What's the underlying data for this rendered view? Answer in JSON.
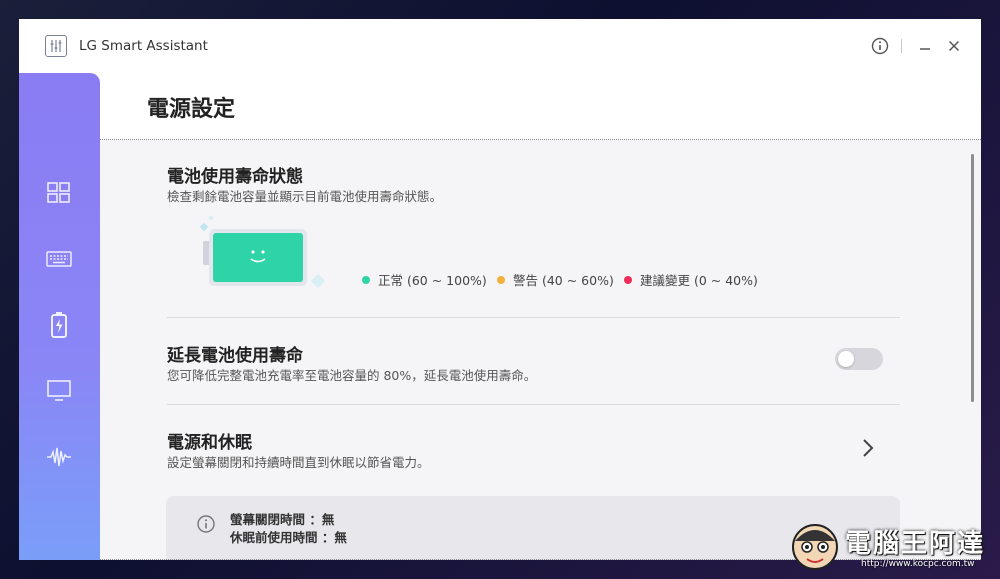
{
  "app": {
    "title": "LG Smart Assistant"
  },
  "titlebar": {
    "info_icon": "info-icon",
    "minimize_icon": "minimize-icon",
    "close_icon": "close-icon"
  },
  "sidebar": {
    "items": [
      {
        "icon": "dashboard-icon"
      },
      {
        "icon": "keyboard-icon"
      },
      {
        "icon": "battery-icon",
        "active": true
      },
      {
        "icon": "monitor-icon"
      },
      {
        "icon": "audio-wave-icon"
      }
    ]
  },
  "page": {
    "title": "電源設定"
  },
  "battery_health": {
    "title": "電池使用壽命狀態",
    "description": "檢查剩餘電池容量並顯示目前電池使用壽命狀態。",
    "legend": [
      {
        "label": "正常 (60 ~ 100%)",
        "color": "#2ed3a8"
      },
      {
        "label": "警告 (40 ~ 60%)",
        "color": "#f0b23a"
      },
      {
        "label": "建議變更 (0 ~ 40%)",
        "color": "#ee2d5a"
      }
    ]
  },
  "extend_battery": {
    "title": "延長電池使用壽命",
    "description": "您可降低完整電池充電率至電池容量的 80%，延長電池使用壽命。",
    "toggle_on": false
  },
  "power_sleep": {
    "title": "電源和休眠",
    "description": "設定螢幕關閉和持續時間直到休眠以節省電力。",
    "info_lines": [
      "螢幕關閉時間 ：無",
      "休眠前使用時間 ：無"
    ]
  },
  "watermark": {
    "text": "電腦王阿達",
    "url": "http://www.kocpc.com.tw"
  }
}
